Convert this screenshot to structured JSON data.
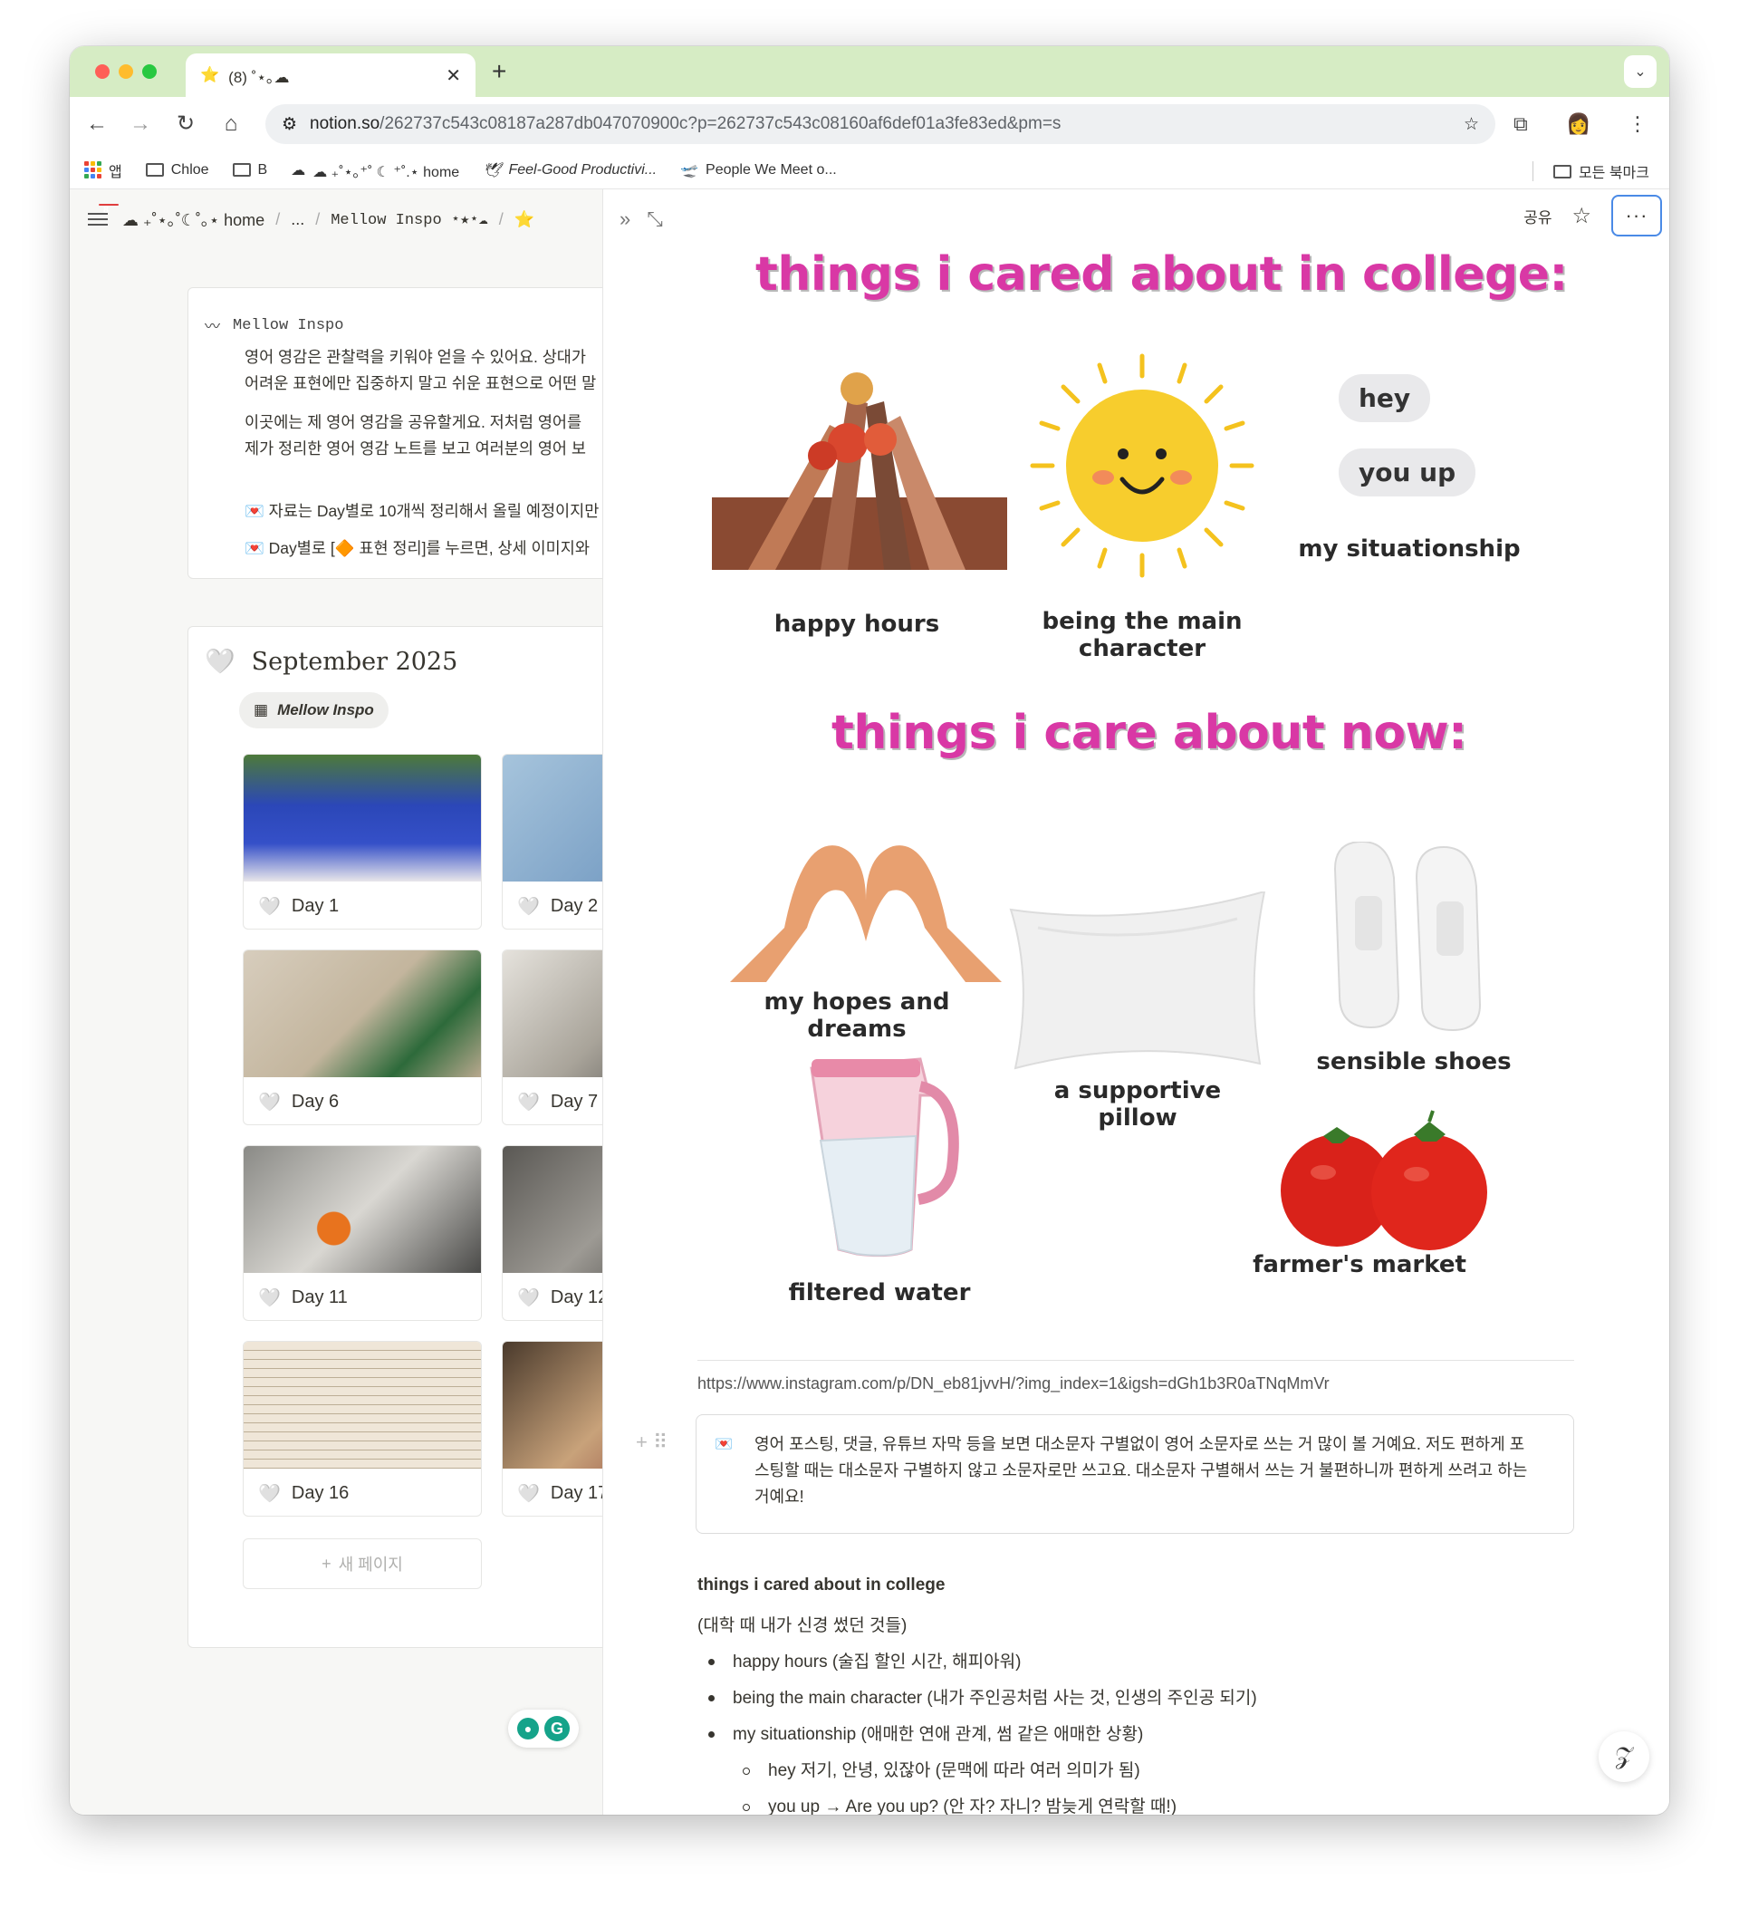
{
  "browser": {
    "tab_title": "(8) ˚⋆｡☁",
    "url_domain": "notion.so",
    "url_path": "/262737c543c08187a287db047070900c?p=262737c543c08160af6def01a3fe83ed&pm=s",
    "bookmarks": [
      "앱",
      "Chloe",
      "B",
      "☁︎ ₊˚⋆｡⁺˚ ☾ ⁺˚.⋆ home",
      "Feel-Good Productivi...",
      "People We Meet o..."
    ],
    "all_bookmarks": "모든 북마크"
  },
  "sidebar_badge": "8",
  "breadcrumb": {
    "home": "☁︎ ₊˚⋆｡˚☾˚｡⋆ home",
    "ellipsis": "...",
    "page": "Mellow Inspo ⋆★⋆☁"
  },
  "callout": {
    "title": "Mellow Inspo",
    "lines": [
      "영어 영감은 관찰력을 키워야 얻을 수 있어요. 상대가",
      "어려운 표현에만 집중하지 말고 쉬운 표현으로 어떤 말",
      "이곳에는 제 영어 영감을 공유할게요. 저처럼 영어를",
      "제가 정리한 영어 영감 노트를 보고 여러분의 영어 보",
      "💌 자료는 Day별로 10개씩 정리해서 올릴 예정이지만",
      "💌 Day별로 [🔶 표현 정리]를 누르면, 상세 이미지와"
    ]
  },
  "database": {
    "title": "September 2025",
    "view": "Mellow Inspo",
    "cards": [
      "Day 1",
      "Day 2",
      "Day 6",
      "Day 7",
      "Day 11",
      "Day 12",
      "Day 16",
      "Day 17"
    ],
    "new_page": "새 페이지"
  },
  "topbar": {
    "share": "공유"
  },
  "infographic": {
    "header1": "things i cared about in college:",
    "header2": "things i care about now:",
    "college_items": [
      "happy hours",
      "being the main",
      "character",
      "my situationship"
    ],
    "bubbles": [
      "hey",
      "you up"
    ],
    "now_items": [
      "my hopes and dreams",
      "a supportive",
      "pillow",
      "sensible shoes",
      "filtered water",
      "farmer's market"
    ]
  },
  "link": "https://www.instagram.com/p/DN_eb81jvvH/?img_index=1&igsh=dGh1b3R0aTNqMmVr",
  "note_callout": {
    "lines": [
      "영어 포스팅, 댓글, 유튜브 자막 등을 보면 대소문자 구별없이 영어 소문자로 쓰는 거 많이 볼 거예요. 저도 편하게 포",
      "스팅할 때는 대소문자 구별하지 않고 소문자로만 쓰고요. 대소문자 구별해서 쓰는 거 불편하니까 편하게 쓰려고 하는",
      "거예요!"
    ]
  },
  "notes": {
    "heading": "things i cared about in college",
    "subheading": "(대학 때 내가 신경 썼던 것들)",
    "bullets": [
      "happy hours (술집 할인 시간, 해피아워)",
      "being the main character (내가 주인공처럼 사는 것, 인생의 주인공 되기)",
      "my situationship (애매한 연애 관계, 썸 같은 애매한 상황)"
    ],
    "subbullets": [
      "hey 저기, 안녕, 있잖아 (문맥에 따라 여러 의미가 됨)",
      "you up → Are you up? (안 자? 자니? 밤늦게 연락할 때!)"
    ]
  },
  "colors": {
    "accent_pink": "#d938a5",
    "tabbar": "#d6ecc4",
    "focus": "#4a8ae6"
  }
}
